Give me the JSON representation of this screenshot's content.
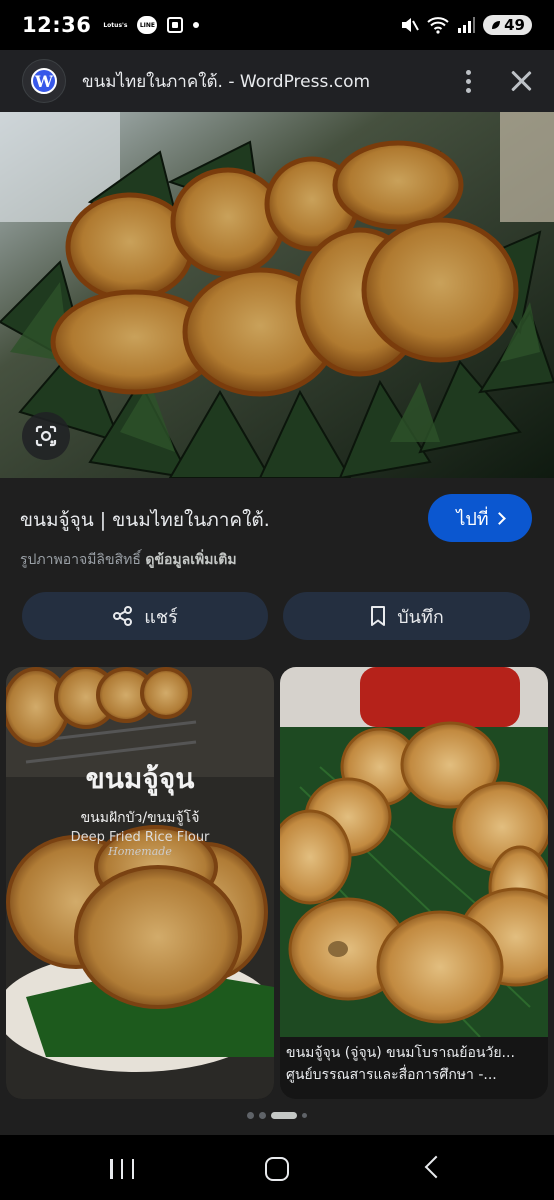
{
  "status_bar": {
    "time": "12:36",
    "notification_icons": [
      "Lotus's",
      "LINE"
    ],
    "battery_level": "49"
  },
  "header": {
    "title": "ขนมไทยในภาคใต้. - WordPress.com",
    "favicon": "wordpress-logo"
  },
  "result": {
    "title": "ขนมจู้จุน | ขนมไทยในภาคใต้.",
    "visit_label": "ไปที่",
    "copyright_text": "รูปภาพอาจมีลิขสิทธิ์",
    "learn_more": "ดูข้อมูลเพิ่มเติม",
    "share_label": "แชร์",
    "save_label": "บันทึก"
  },
  "related": [
    {
      "overlay_title": "ขนมจู้จุน",
      "overlay_sub": "ขนมฝักบัว/ขนมจู้โจ้",
      "overlay_en": "Deep Fried Rice Flour",
      "overlay_script": "Homemade"
    },
    {
      "caption_line1": "ขนมจู้จุน (จู่จุน) ขนมโบราณย้อนวัย...",
      "caption_line2": "ศูนย์บรรณสารและสื่อการศึกษา -..."
    }
  ],
  "carousel": {
    "total": 4,
    "active_index": 2
  },
  "colors": {
    "background": "#1f1f1f",
    "accent_button": "#0b57d0",
    "action_button": "#242f40"
  }
}
